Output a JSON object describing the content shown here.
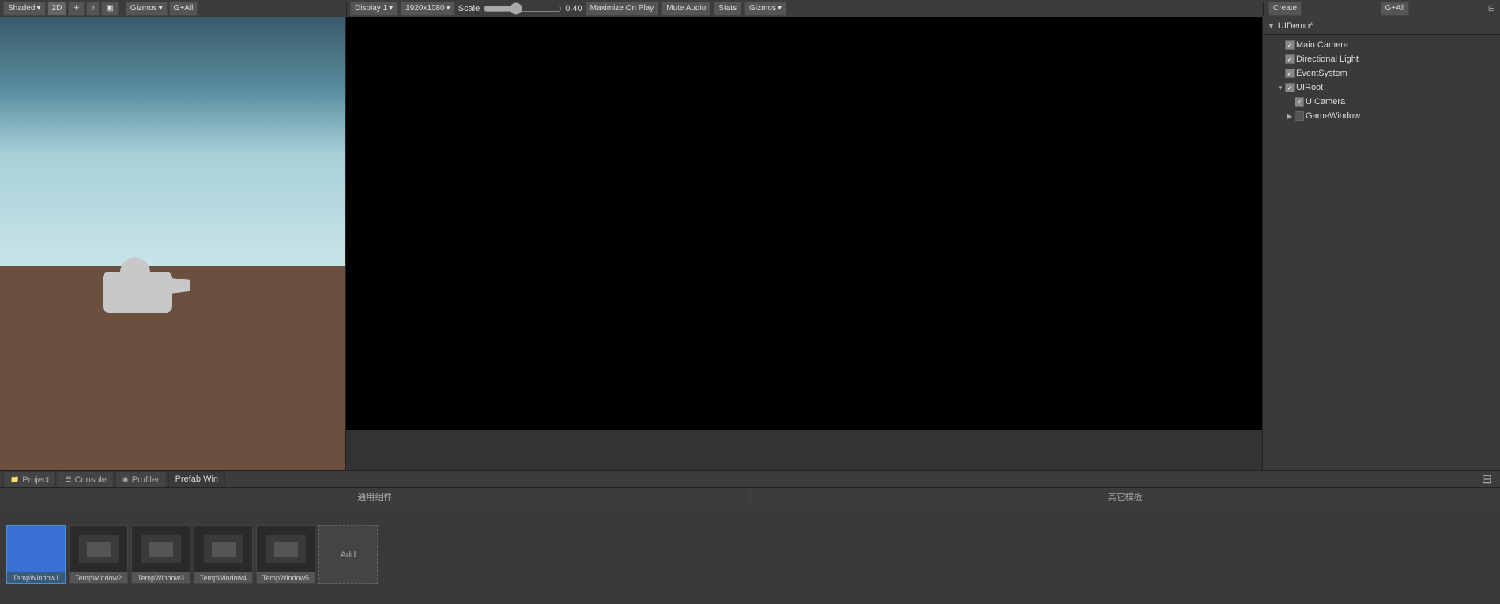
{
  "topToolbar": {
    "shading_label": "Shaded",
    "mode_2d": "2D",
    "gizmos_label": "Gizmos",
    "gizmos_filter": "G+All",
    "display_label": "Display 1",
    "resolution": "1920x1080",
    "scale_label": "Scale",
    "scale_value": "0.40",
    "maximize_on_play": "Maximize On Play",
    "mute_audio": "Mute Audio",
    "stats_label": "Stats",
    "game_gizmos": "Gizmos",
    "create_label": "Create",
    "hierarchy_filter": "G+All"
  },
  "hierarchy": {
    "title": "UIDemo*",
    "items": [
      {
        "label": "Main Camera",
        "indent": "indent1",
        "has_arrow": false,
        "arrow": "",
        "checked": true
      },
      {
        "label": "Directional Light",
        "indent": "indent1",
        "has_arrow": false,
        "arrow": "",
        "checked": true
      },
      {
        "label": "EventSystem",
        "indent": "indent1",
        "has_arrow": false,
        "arrow": "",
        "checked": true
      },
      {
        "label": "UIRoot",
        "indent": "indent1",
        "has_arrow": true,
        "arrow": "▼",
        "checked": true
      },
      {
        "label": "UICamera",
        "indent": "indent2",
        "has_arrow": false,
        "arrow": "",
        "checked": true
      },
      {
        "label": "GameWindow",
        "indent": "indent2",
        "has_arrow": true,
        "arrow": "▶",
        "checked": false
      }
    ]
  },
  "bottomPanel": {
    "tabs": [
      {
        "label": "Project",
        "icon": "📁",
        "active": false
      },
      {
        "label": "Console",
        "icon": "☰",
        "active": false
      },
      {
        "label": "Profiler",
        "icon": "◉",
        "active": false
      },
      {
        "label": "Prefab Win",
        "icon": "",
        "active": true
      }
    ],
    "toolbar_sections": [
      {
        "label": "通用组件"
      },
      {
        "label": "其它模板"
      }
    ],
    "assets": [
      {
        "label": "TempWindow1",
        "type": "selected",
        "preview": "blue"
      },
      {
        "label": "TempWindow2",
        "type": "dark",
        "preview": "dark"
      },
      {
        "label": "TempWindow3",
        "type": "dark",
        "preview": "dark"
      },
      {
        "label": "TempWindow4",
        "type": "dark",
        "preview": "dark"
      },
      {
        "label": "TempWindow5",
        "type": "dark",
        "preview": "dark"
      }
    ],
    "add_label": "Add"
  }
}
